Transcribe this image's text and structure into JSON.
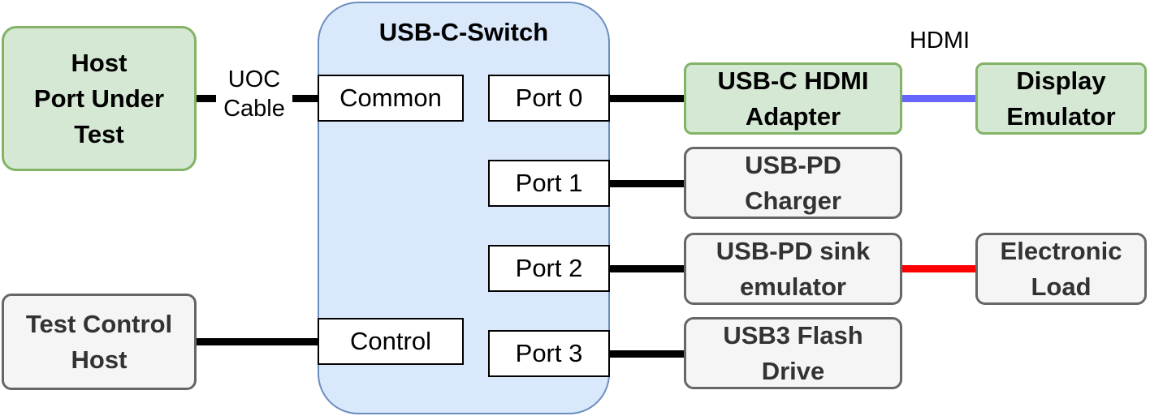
{
  "switch": {
    "title": "USB-C-Switch",
    "common": "Common",
    "control": "Control",
    "ports": [
      "Port 0",
      "Port 1",
      "Port 2",
      "Port 3"
    ]
  },
  "host": {
    "label_lines": [
      "Host",
      "Port Under",
      "Test"
    ]
  },
  "cable": {
    "label_lines": [
      "UOC",
      "Cable"
    ]
  },
  "test_control": {
    "label_lines": [
      "Test Control",
      "Host"
    ]
  },
  "devices": [
    {
      "label_lines": [
        "USB-C HDMI",
        "Adapter"
      ]
    },
    {
      "label_lines": [
        "USB-PD",
        "Charger"
      ]
    },
    {
      "label_lines": [
        "USB-PD sink",
        "emulator"
      ]
    },
    {
      "label_lines": [
        "USB3 Flash",
        "Drive"
      ]
    }
  ],
  "display_emulator": {
    "label_lines": [
      "Display",
      "Emulator"
    ]
  },
  "electronic_load": {
    "label_lines": [
      "Electronic",
      "Load"
    ]
  },
  "hdmi_label": "HDMI",
  "colors": {
    "hdmi_link": "#6666ff",
    "power_link": "#ff0000",
    "green_fill": "#d5e8d4",
    "switch_fill": "#dae8fc",
    "gray_fill": "#f5f5f5"
  }
}
